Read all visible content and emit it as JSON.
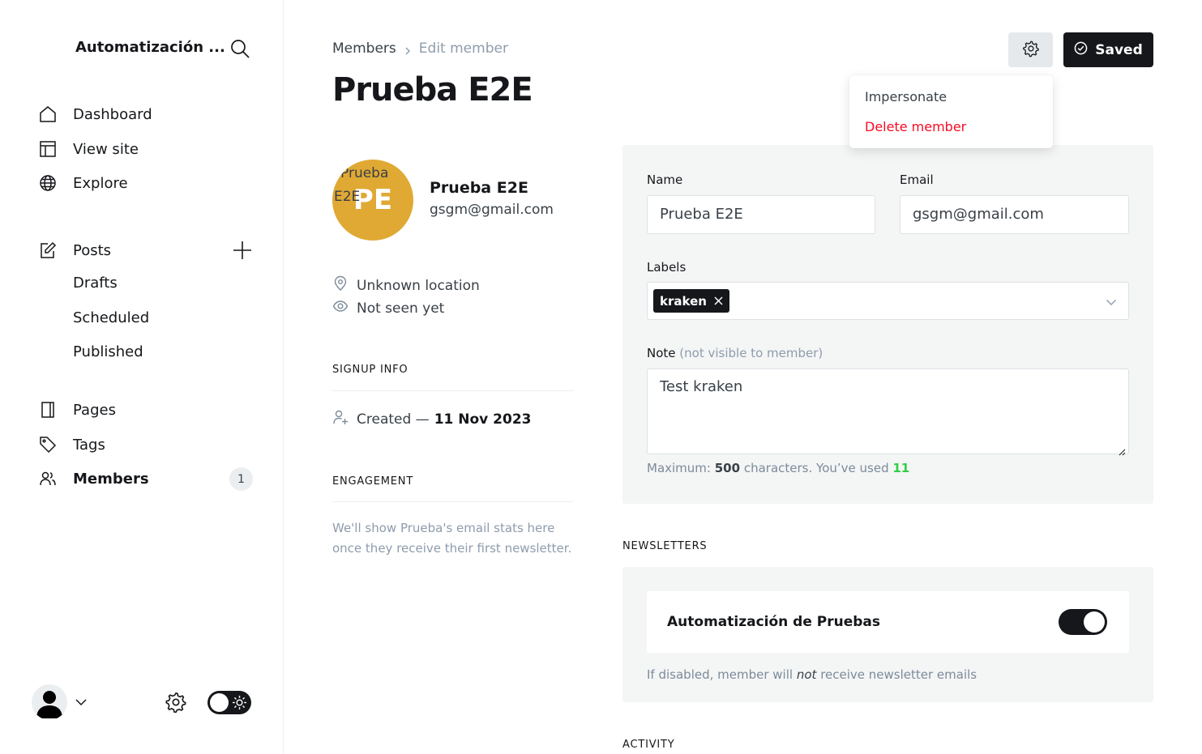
{
  "sidebar": {
    "site_title": "Automatización ...",
    "nav": [
      {
        "label": "Dashboard",
        "icon": "home-icon"
      },
      {
        "label": "View site",
        "icon": "layout-icon"
      },
      {
        "label": "Explore",
        "icon": "globe-icon"
      }
    ],
    "posts": {
      "label": "Posts",
      "icon": "edit-icon"
    },
    "post_subitems": [
      "Drafts",
      "Scheduled",
      "Published"
    ],
    "pages": {
      "label": "Pages",
      "icon": "page-icon"
    },
    "tags": {
      "label": "Tags",
      "icon": "tag-icon"
    },
    "members": {
      "label": "Members",
      "icon": "members-icon",
      "count": "1"
    }
  },
  "header": {
    "breadcrumb_parent": "Members",
    "breadcrumb_current": "Edit member",
    "title": "Prueba E2E",
    "saved_label": "Saved"
  },
  "dropdown": {
    "impersonate": "Impersonate",
    "delete": "Delete member"
  },
  "member": {
    "avatar_alt": "Prueba E2E",
    "initials": "PE",
    "name": "Prueba E2E",
    "email": "gsgm@gmail.com",
    "location": "Unknown location",
    "seen": "Not seen yet",
    "signup_heading": "SIGNUP INFO",
    "created_prefix": "Created —",
    "created_date": "11 Nov 2023",
    "engagement_heading": "ENGAGEMENT",
    "engagement_text": "We'll show Prueba's email stats here once they receive their first newsletter."
  },
  "form": {
    "name_label": "Name",
    "name_value": "Prueba E2E",
    "email_label": "Email",
    "email_value": "gsgm@gmail.com",
    "labels_label": "Labels",
    "labels": [
      "kraken"
    ],
    "note_label": "Note",
    "note_muted": "(not visible to member)",
    "note_value": "Test kraken",
    "hint_prefix": "Maximum:",
    "hint_max": "500",
    "hint_middle": "characters. You’ve used",
    "hint_used": "11"
  },
  "newsletters": {
    "heading": "NEWSLETTERS",
    "name": "Automatización de Pruebas",
    "enabled": true,
    "hint_before": "If disabled, member will",
    "hint_em": "not",
    "hint_after": "receive newsletter emails"
  },
  "activity": {
    "heading": "ACTIVITY"
  },
  "colors": {
    "accent": "#15171a",
    "avatar": "#e0a934",
    "danger": "#f50b23",
    "success": "#30cf43"
  }
}
